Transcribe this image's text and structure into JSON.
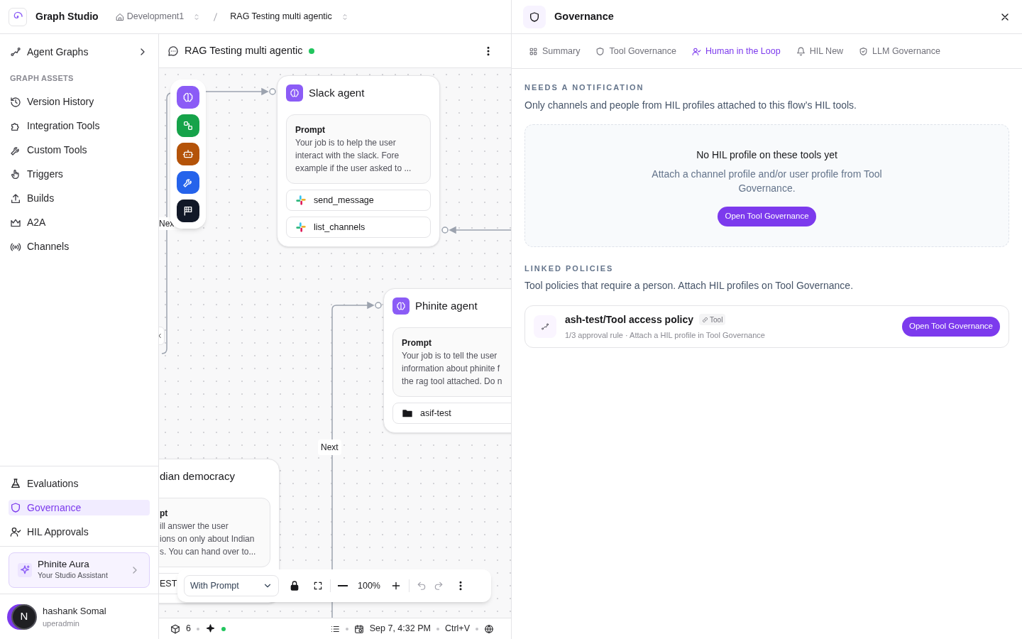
{
  "app": {
    "name": "Graph Studio"
  },
  "breadcrumbs": [
    {
      "label": "Development1"
    },
    {
      "label": "RAG Testing multi agentic"
    }
  ],
  "sidebar": {
    "items": [
      {
        "label": "Agent Graphs",
        "kind": "expandable"
      },
      {
        "label": "GRAPH ASSETS",
        "kind": "section"
      },
      {
        "label": "Version History",
        "kind": "link"
      },
      {
        "label": "Integration Tools",
        "kind": "link"
      },
      {
        "label": "Custom Tools",
        "kind": "link"
      },
      {
        "label": "Triggers",
        "kind": "link"
      },
      {
        "label": "Builds",
        "kind": "link"
      },
      {
        "label": "A2A",
        "kind": "link"
      },
      {
        "label": "Channels",
        "kind": "link"
      }
    ],
    "bottom_items": [
      {
        "label": "Evaluations",
        "selected": false
      },
      {
        "label": "Governance",
        "selected": true
      },
      {
        "label": "HIL Approvals",
        "selected": false
      }
    ],
    "assistant": {
      "title": "Phinite Aura",
      "subtitle": "Your Studio Assistant"
    },
    "user": {
      "avatar": "N",
      "name": "hashank Somal",
      "role": "uperadmin"
    }
  },
  "flow": {
    "title": "RAG Testing multi agentic",
    "online": true
  },
  "canvas": {
    "palette": [
      {
        "color": "#8b5cf6"
      },
      {
        "color": "#16a34a"
      },
      {
        "color": "#b45309"
      },
      {
        "color": "#2563eb"
      },
      {
        "color": "#111827"
      }
    ],
    "edge_labels": [
      "Nex",
      "Next"
    ],
    "nodes": [
      {
        "title": "Slack agent",
        "prompt_label": "Prompt",
        "prompt": [
          "Your job is to help the user",
          "interact with the slack. Fore",
          "example if the user asked to ..."
        ],
        "tools": [
          {
            "kind": "slack",
            "label": "send_message"
          },
          {
            "kind": "slack",
            "label": "list_channels"
          }
        ]
      },
      {
        "title": "Phinite agent",
        "prompt_label": "Prompt",
        "prompt": [
          "Your job is to tell the user",
          "information about phinite f",
          "the rag tool attached. Do n"
        ],
        "tools": [
          {
            "kind": "folder",
            "label": "asif-test"
          }
        ]
      },
      {
        "title": "dian democracy",
        "prompt_label": "pt",
        "prompt": [
          "ill answer the user",
          "ions on only about Indian",
          "s. You can hand over to..."
        ],
        "tools": [
          {
            "kind": "plain",
            "label": "EST"
          }
        ]
      }
    ]
  },
  "toolbar": {
    "mode": "With Prompt",
    "zoom": "100%"
  },
  "status_bar": {
    "count": "6",
    "assistant_online": true,
    "date": "Sep 7, 4:32 PM",
    "shortcut": "Ctrl+V"
  },
  "panel": {
    "title": "Governance",
    "tabs": [
      {
        "label": "Summary",
        "selected": false
      },
      {
        "label": "Tool Governance",
        "selected": false
      },
      {
        "label": "Human in the Loop",
        "selected": true
      },
      {
        "label": "HIL New",
        "selected": false
      },
      {
        "label": "LLM Governance",
        "selected": false
      }
    ],
    "notification": {
      "heading": "NEEDS A NOTIFICATION",
      "description": "Only channels and people from HIL profiles attached to this flow’s HIL tools.",
      "empty": {
        "title": "No HIL profile on these tools yet",
        "text": "Attach a channel profile and/or user profile from Tool Governance.",
        "button": "Open Tool Governance"
      }
    },
    "policies": {
      "heading": "LINKED POLICIES",
      "description": "Tool policies that require a person. Attach HIL profiles on Tool Governance.",
      "items": [
        {
          "name": "ash-test/Tool access policy",
          "tag": "Tool",
          "meta": "1/3 approval rule · Attach a HIL profile in Tool Governance",
          "button": "Open Tool Governance"
        }
      ]
    }
  }
}
